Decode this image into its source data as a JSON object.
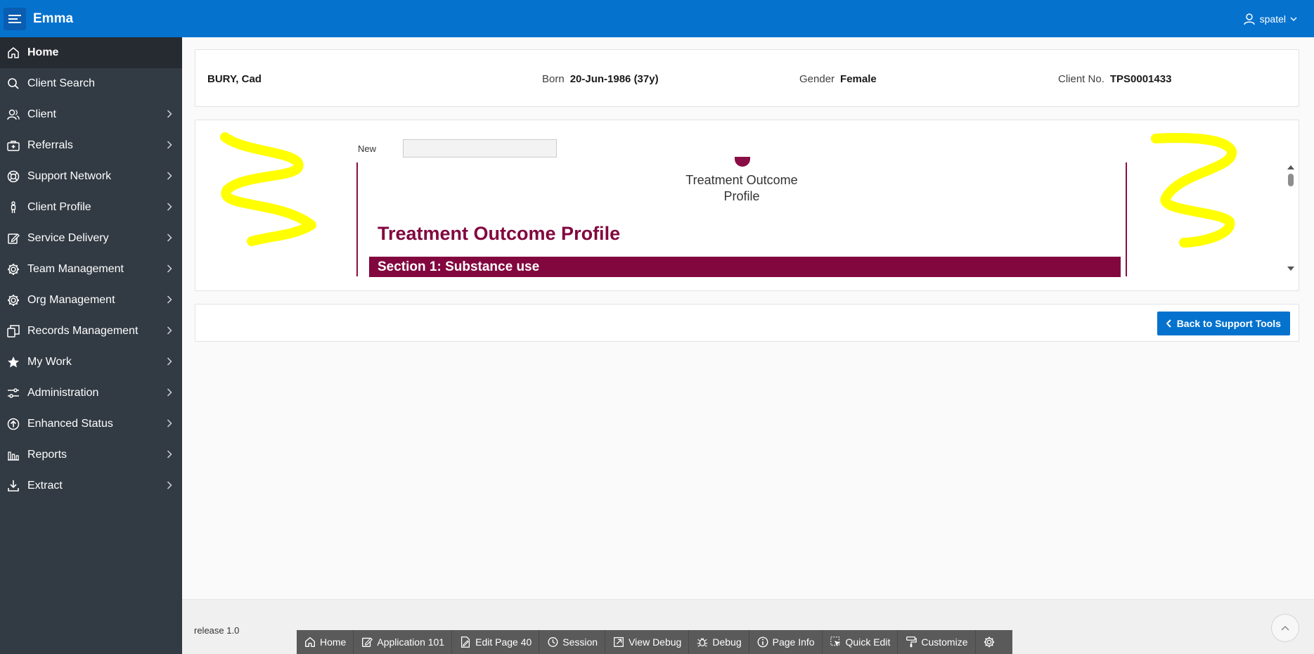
{
  "header": {
    "app_title": "Emma",
    "user_name": "spatel"
  },
  "sidebar": {
    "items": [
      {
        "label": "Home",
        "icon": "home-icon",
        "active": true,
        "expandable": false
      },
      {
        "label": "Client Search",
        "icon": "search-icon",
        "active": false,
        "expandable": false
      },
      {
        "label": "Client",
        "icon": "users-icon",
        "active": false,
        "expandable": true
      },
      {
        "label": "Referrals",
        "icon": "medical-bag-icon",
        "active": false,
        "expandable": true
      },
      {
        "label": "Support Network",
        "icon": "lifebuoy-icon",
        "active": false,
        "expandable": true
      },
      {
        "label": "Client Profile",
        "icon": "person-icon",
        "active": false,
        "expandable": true
      },
      {
        "label": "Service Delivery",
        "icon": "edit-icon",
        "active": false,
        "expandable": true
      },
      {
        "label": "Team Management",
        "icon": "gear-icon",
        "active": false,
        "expandable": true
      },
      {
        "label": "Org Management",
        "icon": "gear-icon",
        "active": false,
        "expandable": true
      },
      {
        "label": "Records Management",
        "icon": "copy-icon",
        "active": false,
        "expandable": true
      },
      {
        "label": "My Work",
        "icon": "star-icon",
        "active": false,
        "expandable": true
      },
      {
        "label": "Administration",
        "icon": "sliders-icon",
        "active": false,
        "expandable": true
      },
      {
        "label": "Enhanced Status",
        "icon": "arrow-up-circle-icon",
        "active": false,
        "expandable": true
      },
      {
        "label": "Reports",
        "icon": "bar-chart-icon",
        "active": false,
        "expandable": true
      },
      {
        "label": "Extract",
        "icon": "download-icon",
        "active": false,
        "expandable": true
      }
    ]
  },
  "client": {
    "name": "BURY, Cad",
    "born_label": "Born",
    "born_value": "20-Jun-1986 (37y)",
    "gender_label": "Gender",
    "gender_value": "Female",
    "client_no_label": "Client No.",
    "client_no_value": "TPS0001433"
  },
  "form": {
    "new_label": "New",
    "new_value": "",
    "doc_subtitle_line1": "Treatment Outcome",
    "doc_subtitle_line2": "Profile",
    "doc_title": "Treatment Outcome Profile",
    "section_title": "Section 1: Substance use"
  },
  "actions": {
    "back_label": "Back to Support Tools"
  },
  "footer": {
    "release": "release 1.0"
  },
  "devbar": {
    "items": [
      {
        "label": "Home",
        "icon": "home-icon"
      },
      {
        "label": "Application 101",
        "icon": "edit-icon"
      },
      {
        "label": "Edit Page 40",
        "icon": "file-edit-icon"
      },
      {
        "label": "Session",
        "icon": "history-icon"
      },
      {
        "label": "View Debug",
        "icon": "external-link-icon"
      },
      {
        "label": "Debug",
        "icon": "bug-icon"
      },
      {
        "label": "Page Info",
        "icon": "info-icon"
      },
      {
        "label": "Quick Edit",
        "icon": "cursor-select-icon"
      },
      {
        "label": "Customize",
        "icon": "paint-roller-icon"
      },
      {
        "label": "",
        "icon": "gear-icon"
      }
    ]
  },
  "colors": {
    "brand": "#0572ce",
    "sidebar": "#323a43",
    "accent": "#82073f",
    "highlight_scribble": "#ffff00"
  }
}
